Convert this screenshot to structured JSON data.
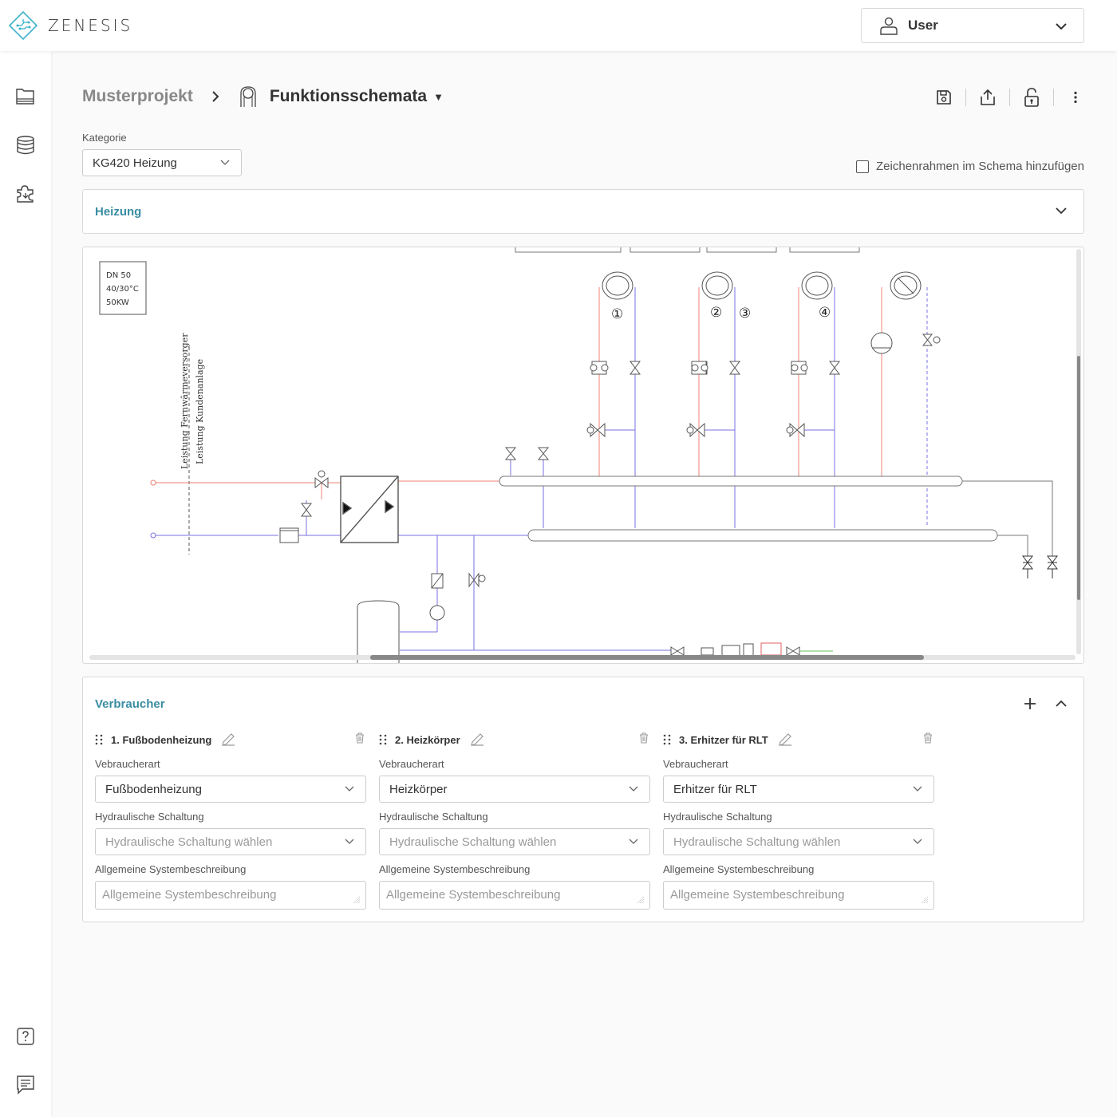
{
  "app": {
    "brand": "ZENESIS",
    "user_label": "User"
  },
  "breadcrumb": {
    "parent": "Musterprojekt",
    "current": "Funktionsschemata",
    "caret": "▼"
  },
  "kategorie": {
    "label": "Kategorie",
    "value": "KG420 Heizung"
  },
  "frame_checkbox": {
    "label": "Zeichenrahmen im Schema hinzufügen",
    "checked": false
  },
  "heizung_panel": {
    "title": "Heizung"
  },
  "diagram": {
    "info_box": [
      "DN 50",
      "40/30°C",
      "50KW"
    ],
    "vertical_labels": [
      "Leistung Fernwärmeversorger",
      "Leistung Kundenanlage"
    ],
    "circuit_numbers": [
      "①",
      "②",
      "③",
      "④"
    ]
  },
  "verbraucher": {
    "title": "Verbraucher",
    "field_labels": {
      "type": "Vebraucherart",
      "hydraulic": "Hydraulische Schaltung",
      "description": "Allgemeine Systembeschreibung"
    },
    "hydraulic_placeholder": "Hydraulische Schaltung wählen",
    "description_placeholder": "Allgemeine Systembeschreibung",
    "items": [
      {
        "title": "1. Fußbodenheizung",
        "type": "Fußbodenheizung"
      },
      {
        "title": "2. Heizkörper",
        "type": "Heizkörper"
      },
      {
        "title": "3. Erhitzer für RLT",
        "type": "Erhitzer für RLT"
      }
    ]
  },
  "colors": {
    "accent": "#3a8da3",
    "logo": "#3bb0c9",
    "supply_pipe": "#f08070",
    "return_pipe": "#7a70e0"
  }
}
